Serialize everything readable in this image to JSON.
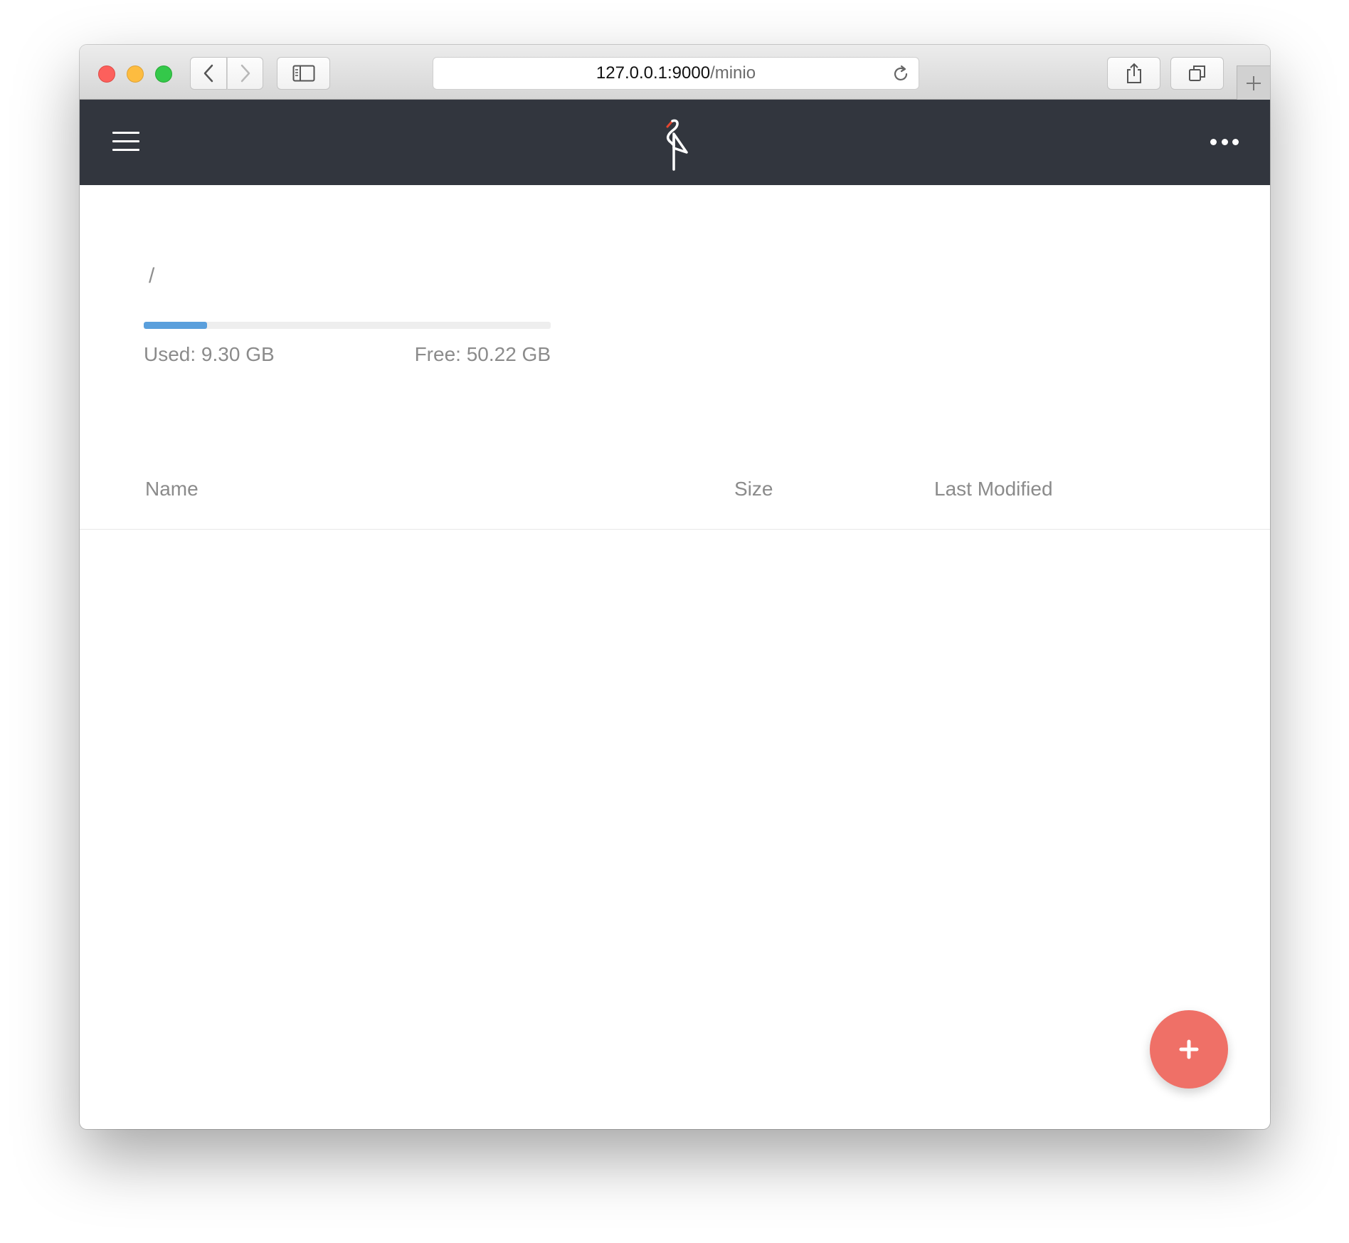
{
  "browser": {
    "url_host": "127.0.0.1:9000",
    "url_path": "/minio"
  },
  "header": {
    "menu_icon": "hamburger-icon",
    "logo_icon": "minio-logo-icon",
    "more_icon": "more-dots-icon"
  },
  "breadcrumb": "/",
  "storage": {
    "used_label": "Used: 9.30 GB",
    "free_label": "Free: 50.22 GB",
    "used_fraction": 0.156
  },
  "table": {
    "columns": [
      "Name",
      "Size",
      "Last Modified"
    ],
    "rows": []
  },
  "fab": {
    "icon": "plus-icon"
  },
  "colors": {
    "header_bg": "#32363e",
    "progress_fill": "#5a9fdc",
    "fab_bg": "#ef7067"
  }
}
